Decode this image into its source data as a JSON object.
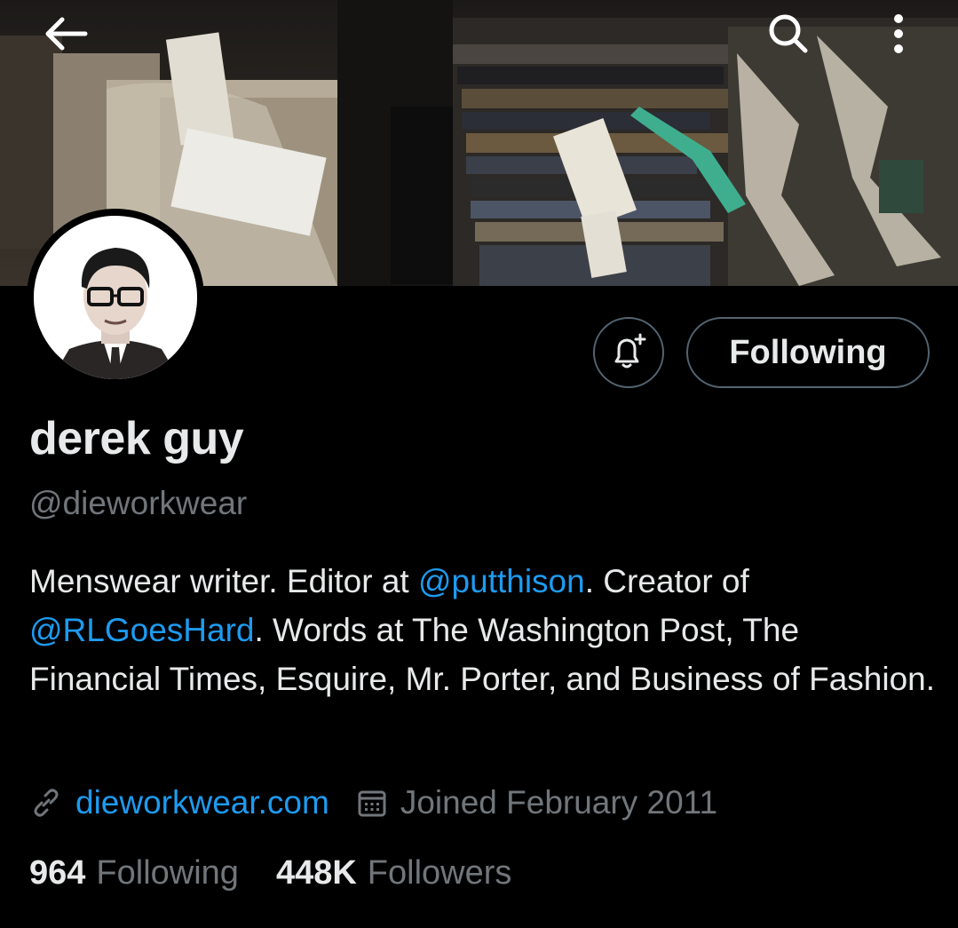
{
  "header": {
    "back_icon": "arrow-left-icon",
    "search_icon": "search-icon",
    "more_icon": "more-vertical-icon"
  },
  "profile": {
    "display_name": "derek guy",
    "handle": "@dieworkwear",
    "bio": {
      "part1": "Menswear writer. Editor at ",
      "mention1": "@putthison",
      "part2": ". Creator of ",
      "mention2": "@RLGoesHard",
      "part3": ". Words at The Washington Post, The Financial Times, Esquire, Mr. Porter, and Business of Fashion."
    },
    "website": "dieworkwear.com",
    "joined": "Joined February 2011",
    "following_count": "964",
    "following_label": "Following",
    "followers_count": "448K",
    "followers_label": "Followers"
  },
  "actions": {
    "notify_icon": "bell-plus-icon",
    "following_button": "Following"
  },
  "colors": {
    "background": "#000000",
    "text_primary": "#e7e9ea",
    "text_secondary": "#71767b",
    "accent": "#1d9bf0",
    "border": "#536471"
  }
}
